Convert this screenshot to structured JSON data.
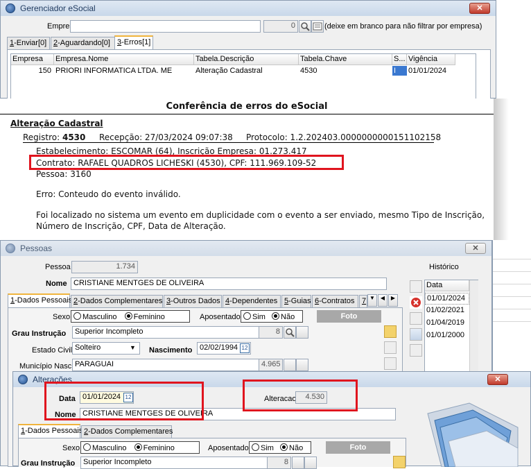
{
  "gerenciador": {
    "title": "Gerenciador eSocial",
    "empresa_label": "Empresa",
    "empresa_value": "0",
    "hint": "(deixe em branco para não filtrar por empresa)",
    "tabs": [
      {
        "key": "1",
        "label": "-Enviar[0]"
      },
      {
        "key": "2",
        "label": "-Aguardando[0]"
      },
      {
        "key": "3",
        "label": "-Erros[1]"
      }
    ],
    "columns": [
      "Empresa",
      "Empresa.Nome",
      "Tabela.Descrição",
      "Tabela.Chave",
      "S...",
      "Vigência"
    ],
    "rows": [
      [
        "150",
        "PRIORI INFORMATICA LTDA. ME",
        "Alteração Cadastral",
        "4530",
        "I",
        "01/01/2024"
      ]
    ]
  },
  "report": {
    "header": "Conferência de erros do eSocial",
    "title": "Alteração Cadastral",
    "registro_label": "Registro:",
    "registro_value": "4530",
    "recepcao": "Recepção: 27/03/2024 09:07:38",
    "protocolo": "Protocolo: 1.2.202403.0000000000151102158",
    "estabelecimento": "Estabelecimento: ESCOMAR (64), Inscrição Empresa: 01.273.417",
    "contrato": "Contrato: RAFAEL QUADROS LICHESKI (4530), CPF: 111.969.109-52",
    "pessoa": "Pessoa: 3160",
    "erro": "Erro: Conteudo do evento inválido.",
    "msg1": "Foi localizado no sistema um evento em duplicidade com o evento a ser enviado, mesmo Tipo de Inscrição,",
    "msg2": "Número de Inscrição, CPF, Data de Alteração."
  },
  "pessoas": {
    "title": "Pessoas",
    "pessoa_label": "Pessoa",
    "pessoa_value": "1.734",
    "nome_label": "Nome",
    "nome_value": "CRISTIANE MENTGES DE OLIVEIRA",
    "historico_label": "Histórico",
    "historico_col": "Data",
    "historico_dates": [
      "01/01/2024",
      "01/02/2021",
      "01/04/2019",
      "01/01/2000"
    ],
    "tabs": [
      {
        "key": "1",
        "label": "-Dados Pessoais"
      },
      {
        "key": "2",
        "label": "-Dados Complementares"
      },
      {
        "key": "3",
        "label": "-Outros Dados"
      },
      {
        "key": "4",
        "label": "-Dependentes"
      },
      {
        "key": "5",
        "label": "-Guias"
      },
      {
        "key": "6",
        "label": "-Contratos"
      },
      {
        "key": "7",
        "label": "-"
      }
    ],
    "sexo_label": "Sexo",
    "masculino": "Masculino",
    "feminino": "Feminino",
    "aposentado_label": "Aposentado",
    "sim": "Sim",
    "nao": "Não",
    "foto": "Foto",
    "grau_label": "Grau Instrução",
    "grau_value": "Superior Incompleto",
    "grau_code": "8",
    "estado_civil_label": "Estado Civil",
    "estado_civil_value": "Solteiro",
    "nascimento_label": "Nascimento",
    "nascimento_value": "02/02/1994",
    "municipio_label": "Município Nasc.",
    "municipio_value": "PARAGUAI",
    "municipio_code": "4.965"
  },
  "alteracoes": {
    "title": "Alterações",
    "data_label": "Data",
    "data_value": "01/01/2024",
    "alteracao_label": "Alteracao",
    "alteracao_value": "4.530",
    "nome_label": "Nome",
    "nome_value": "CRISTIANE MENTGES DE OLIVEIRA",
    "tabs": [
      {
        "key": "1",
        "label": "-Dados Pessoais"
      },
      {
        "key": "2",
        "label": "-Dados Complementares"
      }
    ],
    "sexo_label": "Sexo",
    "masculino": "Masculino",
    "feminino": "Feminino",
    "aposentado_label": "Aposentado",
    "sim": "Sim",
    "nao": "Não",
    "foto": "Foto",
    "grau_label": "Grau Instrução",
    "grau_value": "Superior Incompleto",
    "grau_code": "8"
  },
  "colors": {
    "highlight": "#e0141e",
    "title_bg": "#c9d8ea"
  }
}
